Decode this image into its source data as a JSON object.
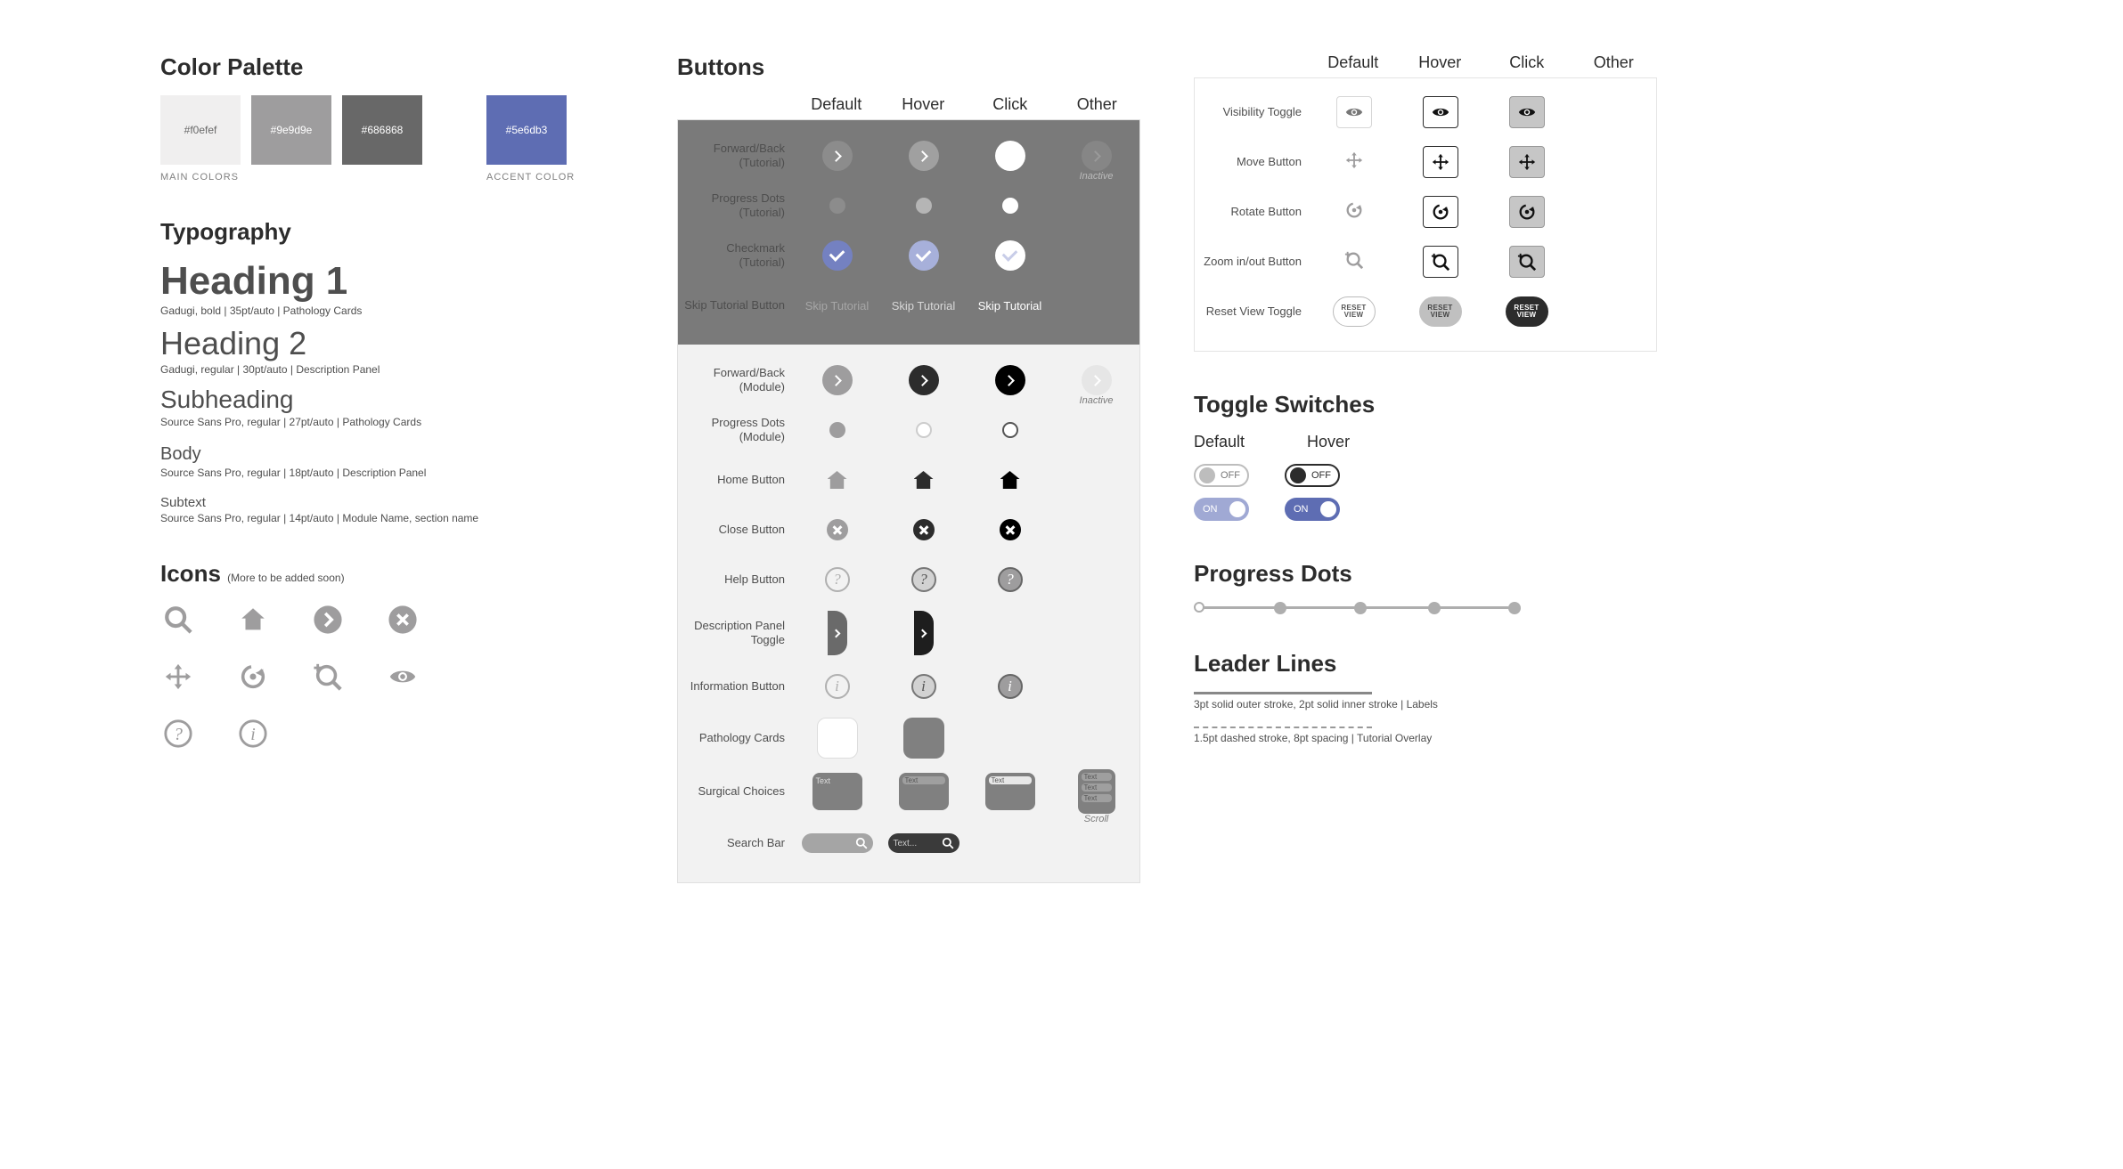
{
  "palette": {
    "title": "Color Palette",
    "main_label": "MAIN COLORS",
    "accent_label": "ACCENT COLOR",
    "swatches": [
      {
        "hex": "#f0efef",
        "text": "#686868"
      },
      {
        "hex": "#9e9d9e",
        "text": "#ffffff"
      },
      {
        "hex": "#686868",
        "text": "#ffffff"
      }
    ],
    "accent": {
      "hex": "#5e6db3",
      "text": "#ffffff"
    }
  },
  "typography": {
    "title": "Typography",
    "h1": {
      "sample": "Heading 1",
      "meta": "Gadugi, bold  |  35pt/auto | Pathology Cards"
    },
    "h2": {
      "sample": "Heading 2",
      "meta": "Gadugi, regular  |  30pt/auto | Description Panel"
    },
    "sub": {
      "sample": "Subheading",
      "meta": "Source Sans Pro, regular  |  27pt/auto | Pathology Cards"
    },
    "body": {
      "sample": "Body",
      "meta": " Source Sans Pro, regular  |  18pt/auto | Description Panel"
    },
    "subtext": {
      "sample": "Subtext",
      "meta": " Source Sans Pro, regular  |  14pt/auto | Module Name, section name"
    }
  },
  "icons": {
    "title": "Icons",
    "note": "(More to be added soon)"
  },
  "buttons": {
    "title": "Buttons",
    "cols": [
      "Default",
      "Hover",
      "Click",
      "Other"
    ],
    "inactive": "Inactive",
    "scroll": "Scroll",
    "surg_text": "Text",
    "search_text": "Text...",
    "rows_dark": [
      "Forward/Back (Tutorial)",
      "Progress Dots (Tutorial)",
      "Checkmark (Tutorial)",
      "Skip Tutorial Button"
    ],
    "rows_light": [
      "Forward/Back (Module)",
      "Progress Dots (Module)",
      "Home Button",
      "Close Button",
      "Help Button",
      "Description Panel Toggle",
      "Information Button",
      "Pathology Cards",
      "Surgical Choices",
      "Search Bar"
    ],
    "skip_label": "Skip Tutorial"
  },
  "right_buttons": {
    "cols": [
      "Default",
      "Hover",
      "Click",
      "Other"
    ],
    "rows": [
      "Visibility Toggle",
      "Move Button",
      "Rotate Button",
      "Zoom in/out Button",
      "Reset View Toggle"
    ],
    "reset_label_1": "RESET",
    "reset_label_2": "VIEW"
  },
  "toggles": {
    "title": "Toggle Switches",
    "cols": [
      "Default",
      "Hover"
    ],
    "off": "OFF",
    "on": "ON"
  },
  "progress": {
    "title": "Progress Dots"
  },
  "leader": {
    "title": "Leader Lines",
    "solid_meta": "3pt solid outer stroke, 2pt solid inner stroke | Labels",
    "dash_meta": "1.5pt dashed stroke, 8pt spacing | Tutorial Overlay"
  }
}
